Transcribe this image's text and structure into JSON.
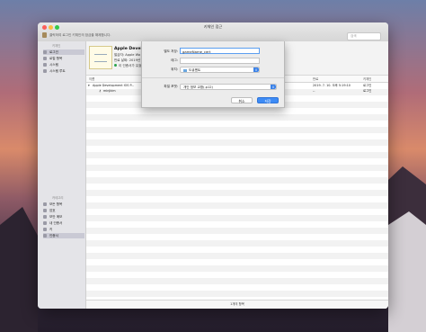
{
  "window": {
    "title": "키체인 접근",
    "lock_hint": "클릭하여 로그인 키체인의 잠금을 해제합니다.",
    "search_placeholder": "검색"
  },
  "sidebar": {
    "keychains_header": "키체인",
    "keychains": [
      {
        "label": "로그인",
        "selected": true
      },
      {
        "label": "로컬 항목",
        "selected": false
      },
      {
        "label": "시스템",
        "selected": false
      },
      {
        "label": "시스템 루트",
        "selected": false
      }
    ],
    "category_header": "카테고리",
    "categories": [
      {
        "label": "모든 항목",
        "selected": false
      },
      {
        "label": "암호",
        "selected": false
      },
      {
        "label": "보안 메모",
        "selected": false
      },
      {
        "label": "내 인증서",
        "selected": false
      },
      {
        "label": "키",
        "selected": false
      },
      {
        "label": "인증서",
        "selected": true
      }
    ]
  },
  "cert_header": {
    "title": "Apple Develo",
    "line1": "발급자: Apple Wo",
    "line2": "만료 날짜: 2019년",
    "line3": "이 인증서가 유효함"
  },
  "columns": {
    "name": "이름",
    "expires": "만료",
    "keychain": "키체인"
  },
  "rows": [
    {
      "name": "Apple Development IOS P...",
      "expires": "2019. 7. 10. 오후 5:19:10",
      "keychain": "로그인"
    },
    {
      "name": "minjkim",
      "expires": "--",
      "keychain": "로그인"
    }
  ],
  "status_bar": "1개의 항목",
  "dialog": {
    "save_as_label": "별도 저장:",
    "save_as_value": "gameName_cert",
    "tags_label": "태그:",
    "tags_value": "",
    "where_label": "위치:",
    "where_value": "도큐멘트",
    "format_label": "파일 포맷:",
    "format_value": "개인 정보 교환(.p12)",
    "cancel_label": "취소",
    "save_label": "저장"
  }
}
